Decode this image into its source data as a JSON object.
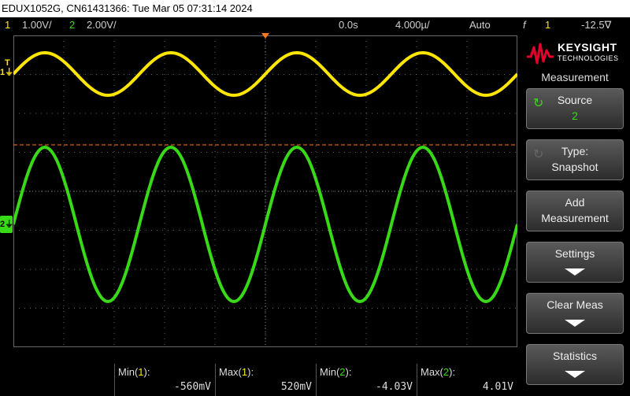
{
  "title_bar": "EDUX1052G, CN61431366: Tue Mar 05 07:31:14 2024",
  "status": {
    "ch1_num": "1",
    "ch1_scale": "1.00V/",
    "ch2_num": "2",
    "ch2_scale": "2.00V/",
    "delay": "0.0s",
    "timebase": "4.000µ/",
    "trigger_mode": "Auto",
    "trigger_icon": "f",
    "trigger_source": "1",
    "trigger_level": "-12.5∇"
  },
  "markers": {
    "trigger_T": "T",
    "ch1_ground": "1",
    "ch2_ground": "2"
  },
  "colors": {
    "ch1": "#ffe600",
    "ch2": "#38d917",
    "trigger_line": "#ff7a1a",
    "grid": "#666666"
  },
  "measurements": [
    {
      "label": "Min(",
      "ch": "1",
      "close": "):",
      "value": "-560mV",
      "color": "yellow"
    },
    {
      "label": "Max(",
      "ch": "1",
      "close": "):",
      "value": "520mV",
      "color": "yellow"
    },
    {
      "label": "Min(",
      "ch": "2",
      "close": "):",
      "value": "-4.03V",
      "color": "green"
    },
    {
      "label": "Max(",
      "ch": "2",
      "close": "):",
      "value": "4.01V",
      "color": "green"
    }
  ],
  "side": {
    "logo_name": "KEYSIGHT",
    "logo_sub": "TECHNOLOGIES",
    "menu_title": "Measurement",
    "softkeys": [
      {
        "line1": "Source",
        "line2": "2"
      },
      {
        "line1": "Type:",
        "line2": "Snapshot"
      },
      {
        "line1": "Add",
        "line2": "Measurement"
      },
      {
        "line1": "Settings",
        "line2": ""
      },
      {
        "line1": "Clear Meas",
        "line2": ""
      },
      {
        "line1": "Statistics",
        "line2": ""
      }
    ]
  }
}
